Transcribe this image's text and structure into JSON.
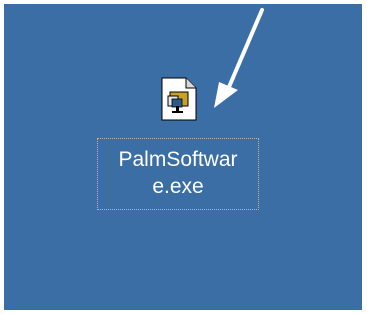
{
  "desktop": {
    "background_color": "#3a6ea5",
    "icon": {
      "name": "PalmSoftware.exe",
      "label_line1": "PalmSoftwar",
      "label_line2": "e.exe",
      "icon_type": "executable-file-icon"
    },
    "annotation": {
      "arrow_color": "#ffffff"
    }
  }
}
